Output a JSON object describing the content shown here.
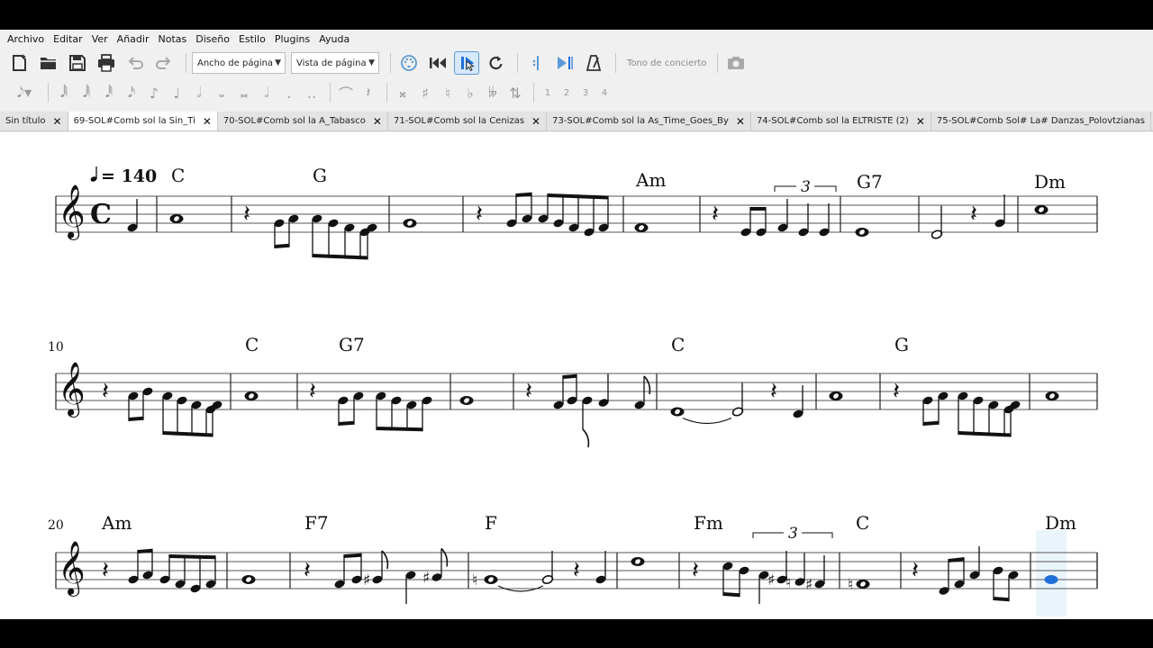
{
  "menu": [
    "Archivo",
    "Editar",
    "Ver",
    "Añadir",
    "Notas",
    "Diseño",
    "Estilo",
    "Plugins",
    "Ayuda"
  ],
  "toolbar": {
    "page_width_combo": "Ancho de página",
    "view_combo": "Vista de página",
    "concert_pitch": "Tono de concierto"
  },
  "voices": [
    "1",
    "2",
    "3",
    "4"
  ],
  "tabs": [
    {
      "label": "Sin título",
      "active": false
    },
    {
      "label": "69-SOL#Comb  sol la  Sin_Ti",
      "active": true
    },
    {
      "label": "70-SOL#Comb  sol la  A_Tabasco",
      "active": false
    },
    {
      "label": "71-SOL#Comb  sol la  Cenizas",
      "active": false
    },
    {
      "label": "73-SOL#Comb  sol la  As_Time_Goes_By",
      "active": false
    },
    {
      "label": "74-SOL#Comb  sol la  ELTRISTE (2)",
      "active": false
    },
    {
      "label": "75-SOL#Comb  Sol# La#  Danzas_Polovtzianas",
      "active": false
    }
  ],
  "score": {
    "tempo": "= 140",
    "measure_numbers": [
      "10",
      "20"
    ],
    "tuplet_label": "3",
    "chords": [
      {
        "system": 0,
        "label": "C"
      },
      {
        "system": 0,
        "label": "G"
      },
      {
        "system": 0,
        "label": "Am"
      },
      {
        "system": 0,
        "label": "G7"
      },
      {
        "system": 0,
        "label": "Dm"
      },
      {
        "system": 1,
        "label": "C"
      },
      {
        "system": 1,
        "label": "G7"
      },
      {
        "system": 1,
        "label": "C"
      },
      {
        "system": 1,
        "label": "G"
      },
      {
        "system": 2,
        "label": "Am"
      },
      {
        "system": 2,
        "label": "F7"
      },
      {
        "system": 2,
        "label": "F"
      },
      {
        "system": 2,
        "label": "Fm"
      },
      {
        "system": 2,
        "label": "C"
      },
      {
        "system": 2,
        "label": "Dm"
      }
    ]
  },
  "colors": {
    "selection": "#1e6fd9",
    "accent": "#5b9bd5"
  }
}
